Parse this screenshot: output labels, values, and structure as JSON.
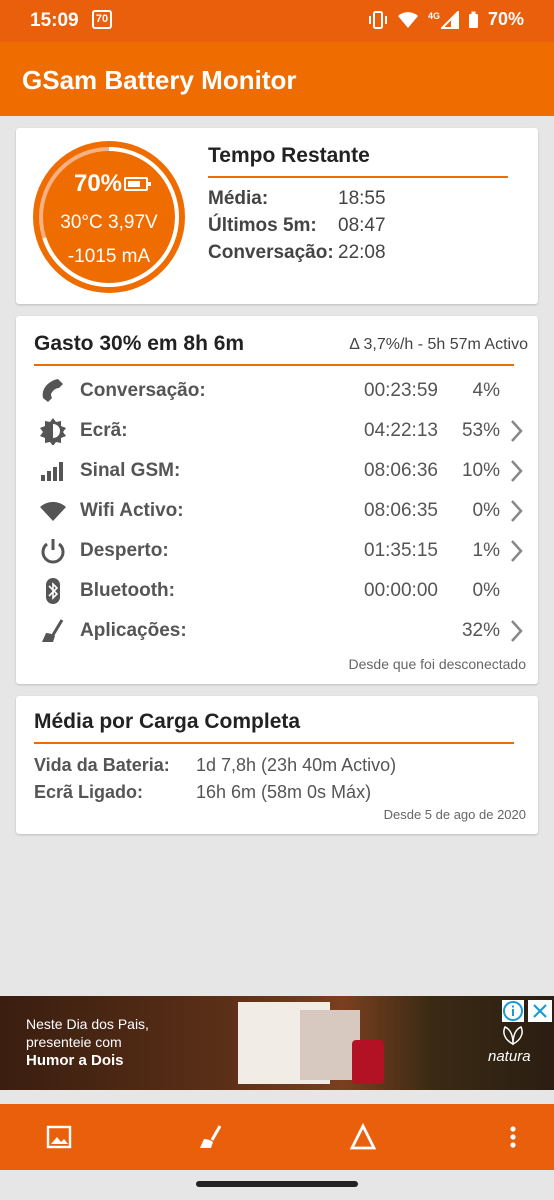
{
  "status_bar": {
    "time": "15:09",
    "notification_badge": "70",
    "network": "4G",
    "battery_percent": "70%"
  },
  "app_bar": {
    "title": "GSam Battery Monitor"
  },
  "gauge": {
    "percent": "70%",
    "level": 0.7,
    "temp_voltage": "30°C  3,97V",
    "current": "-1015 mA"
  },
  "time_remaining": {
    "title": "Tempo Restante",
    "rows": [
      {
        "label": "Média:",
        "value": "18:55"
      },
      {
        "label": "Últimos 5m:",
        "value": "08:47"
      },
      {
        "label": "Conversação:",
        "value": "22:08"
      }
    ]
  },
  "usage": {
    "title": "Gasto 30% em 8h 6m",
    "rate": "Δ 3,7%/h - 5h 57m Activo",
    "rows": [
      {
        "icon": "phone-icon",
        "name": "Conversação:",
        "duration": "00:23:59",
        "percent": "4%",
        "chevron": false
      },
      {
        "icon": "screen-brightness-icon",
        "name": "Ecrã:",
        "duration": "04:22:13",
        "percent": "53%",
        "chevron": true
      },
      {
        "icon": "signal-bars-icon",
        "name": "Sinal GSM:",
        "duration": "08:06:36",
        "percent": "10%",
        "chevron": true
      },
      {
        "icon": "wifi-icon",
        "name": "Wifi Activo:",
        "duration": "08:06:35",
        "percent": "0%",
        "chevron": true
      },
      {
        "icon": "power-icon",
        "name": "Desperto:",
        "duration": "01:35:15",
        "percent": "1%",
        "chevron": true
      },
      {
        "icon": "bluetooth-icon",
        "name": "Bluetooth:",
        "duration": "00:00:00",
        "percent": "0%",
        "chevron": false
      },
      {
        "icon": "apps-broom-icon",
        "name": "Aplicações:",
        "duration": "",
        "percent": "32%",
        "chevron": true
      }
    ],
    "since": "Desde que foi desconectado"
  },
  "full_charge": {
    "title": "Média por Carga Completa",
    "rows": [
      {
        "label": "Vida da Bateria:",
        "value": "1d 7,8h (23h 40m Activo)"
      },
      {
        "label": "Ecrã Ligado:",
        "value": "16h 6m (58m 0s Máx)"
      }
    ],
    "since": "Desde 5 de ago de 2020"
  },
  "ad": {
    "line1": "Neste Dia dos Pais,",
    "line2": "presenteie com",
    "line3": "Humor a Dois",
    "brand": "natura"
  },
  "bottom_bar": {
    "buttons": [
      "image-icon",
      "broom-icon",
      "delta-icon",
      "more-vert-icon"
    ]
  },
  "colors": {
    "accent": "#ef6c00",
    "status_bar": "#ea5f0c",
    "background": "#e6e6e6",
    "gauge_fill": "#ef6c00"
  }
}
